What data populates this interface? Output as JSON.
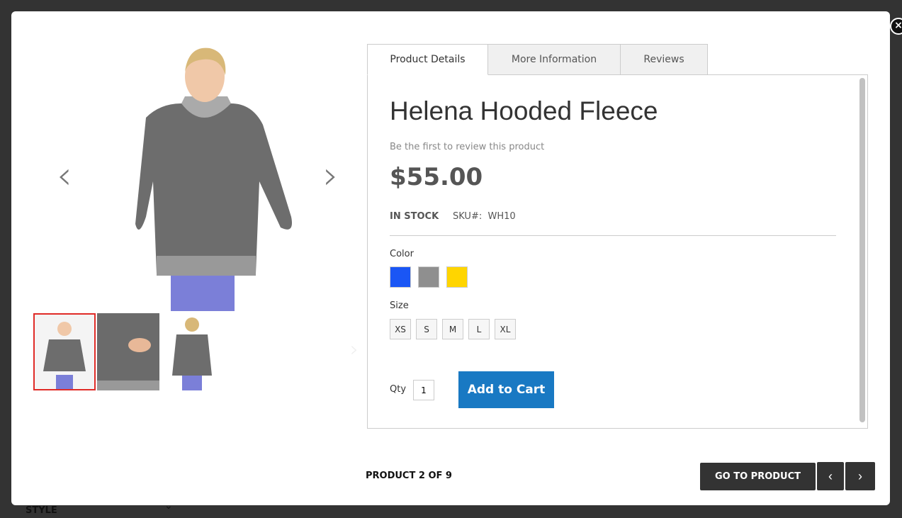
{
  "background": {
    "filter_label": "STYLE"
  },
  "gallery": {
    "images": [
      "front",
      "pocket detail",
      "back"
    ],
    "active_index": 0
  },
  "tabs": [
    {
      "label": "Product Details",
      "active": true
    },
    {
      "label": "More Information",
      "active": false
    },
    {
      "label": "Reviews",
      "active": false
    }
  ],
  "product": {
    "name": "Helena Hooded Fleece",
    "review_link": "Be the first to review this product",
    "price": "$55.00",
    "stock": "IN STOCK",
    "sku_label": "SKU#:",
    "sku": "WH10",
    "color_label": "Color",
    "colors": [
      "#1a56f5",
      "#8f8f8f",
      "#ffd500"
    ],
    "size_label": "Size",
    "sizes": [
      "XS",
      "S",
      "M",
      "L",
      "XL"
    ],
    "qty_label": "Qty",
    "qty": "1",
    "add_to_cart": "Add to Cart"
  },
  "footer": {
    "counter": "PRODUCT 2 OF 9",
    "go_to_product": "GO TO PRODUCT"
  },
  "colors": {
    "accent": "#1979c3",
    "active_thumb": "#e02b27",
    "dark_button": "#333333"
  }
}
